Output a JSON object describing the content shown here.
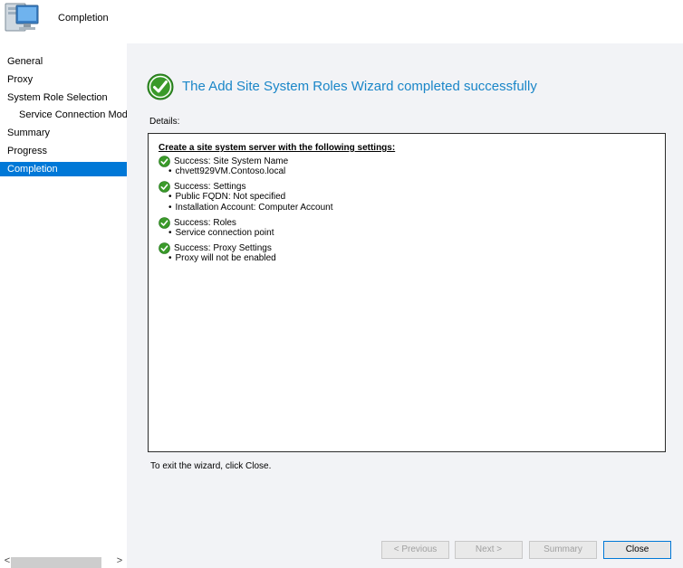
{
  "header": {
    "title": "Completion",
    "icon": "computer-icon"
  },
  "sidebar": {
    "items": [
      {
        "label": "General",
        "sub": false,
        "active": false
      },
      {
        "label": "Proxy",
        "sub": false,
        "active": false
      },
      {
        "label": "System Role Selection",
        "sub": false,
        "active": false
      },
      {
        "label": "Service Connection Mode",
        "sub": true,
        "active": false
      },
      {
        "label": "Summary",
        "sub": false,
        "active": false
      },
      {
        "label": "Progress",
        "sub": false,
        "active": false
      },
      {
        "label": "Completion",
        "sub": false,
        "active": true
      }
    ]
  },
  "main": {
    "banner": "The Add Site System Roles Wizard completed successfully",
    "details_label": "Details:",
    "details": {
      "heading": "Create a site system server with the following settings:",
      "items": [
        {
          "title": "Success: Site System Name",
          "details": [
            "chvett929VM.Contoso.local"
          ]
        },
        {
          "title": "Success: Settings",
          "details": [
            "Public FQDN: Not specified",
            "Installation Account: Computer Account"
          ]
        },
        {
          "title": "Success: Roles",
          "details": [
            "Service connection point"
          ]
        },
        {
          "title": "Success: Proxy Settings",
          "details": [
            "Proxy will not be enabled"
          ]
        }
      ]
    },
    "exit_text": "To exit the wizard, click Close."
  },
  "buttons": {
    "previous": "< Previous",
    "next": "Next >",
    "summary": "Summary",
    "close": "Close"
  },
  "colors": {
    "accent": "#0078d7",
    "banner_text": "#1a86c8",
    "success_green": "#3a9a2a"
  }
}
